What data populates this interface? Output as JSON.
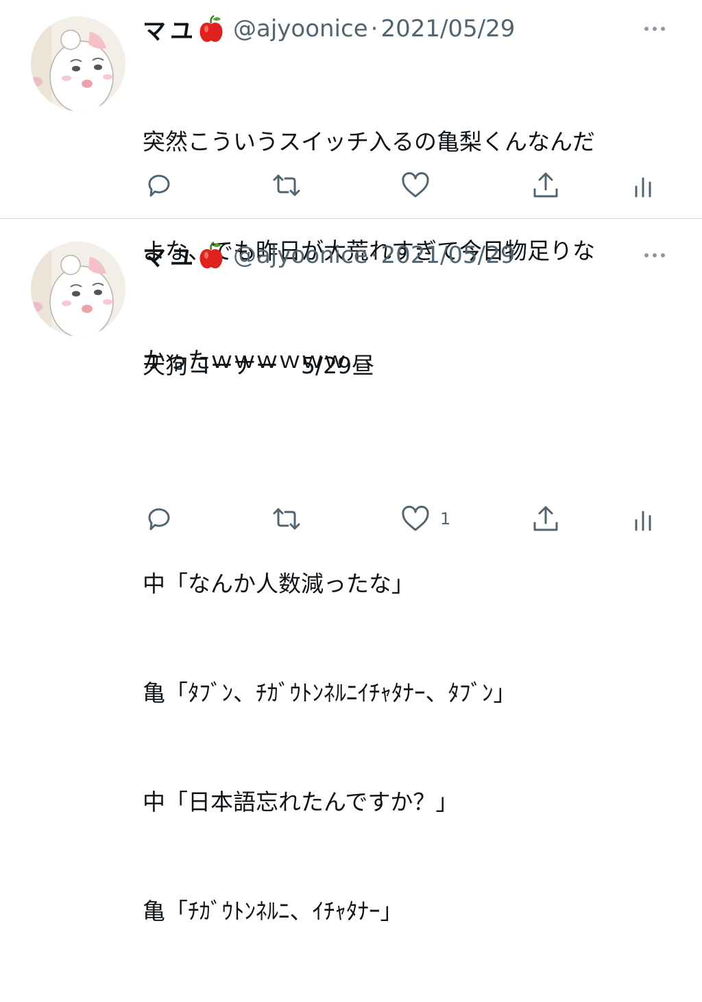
{
  "tweets": [
    {
      "author": {
        "name": "マユ",
        "emoji_icon": "red-apple-icon",
        "handle": "@ajyoonice",
        "separator": "·",
        "date": "2021/05/29"
      },
      "text_lines": [
        "突然こういうスイッチ入るの亀梨くんなんだ",
        "よな、でも昨日が大荒れすぎて今日物足りな",
        "かったｗｗｗｗｗｗ"
      ],
      "actions": {
        "reply_icon": "reply-icon",
        "retweet_icon": "retweet-icon",
        "like_icon": "heart-icon",
        "like_count": "",
        "share_icon": "share-icon",
        "analytics_icon": "analytics-icon"
      }
    },
    {
      "author": {
        "name": "マユ",
        "emoji_icon": "red-apple-icon",
        "handle": "@ajyoonice",
        "separator": "·",
        "date": "2021/05/29"
      },
      "text_lines": [
        "天狗コーナー　5/29昼",
        "",
        "中「なんか人数減ったな」",
        "亀「ﾀﾌﾞﾝ、ﾁｶﾞｳﾄﾝﾈﾙﾆｲﾁｬﾀﾅｰ、ﾀﾌﾞﾝ」",
        "中「日本語忘れたんですか？」",
        "亀「ﾁｶﾞｳﾄﾝﾈﾙﾆ、ｲﾁｬﾀﾅｰ」"
      ],
      "actions": {
        "reply_icon": "reply-icon",
        "retweet_icon": "retweet-icon",
        "like_icon": "heart-icon",
        "like_count": "1",
        "share_icon": "share-icon",
        "analytics_icon": "analytics-icon"
      }
    }
  ],
  "colors": {
    "text": "#0f1419",
    "secondary": "#536471",
    "icon": "#536471",
    "divider": "#cfd9de",
    "apple": "#e0221f"
  }
}
